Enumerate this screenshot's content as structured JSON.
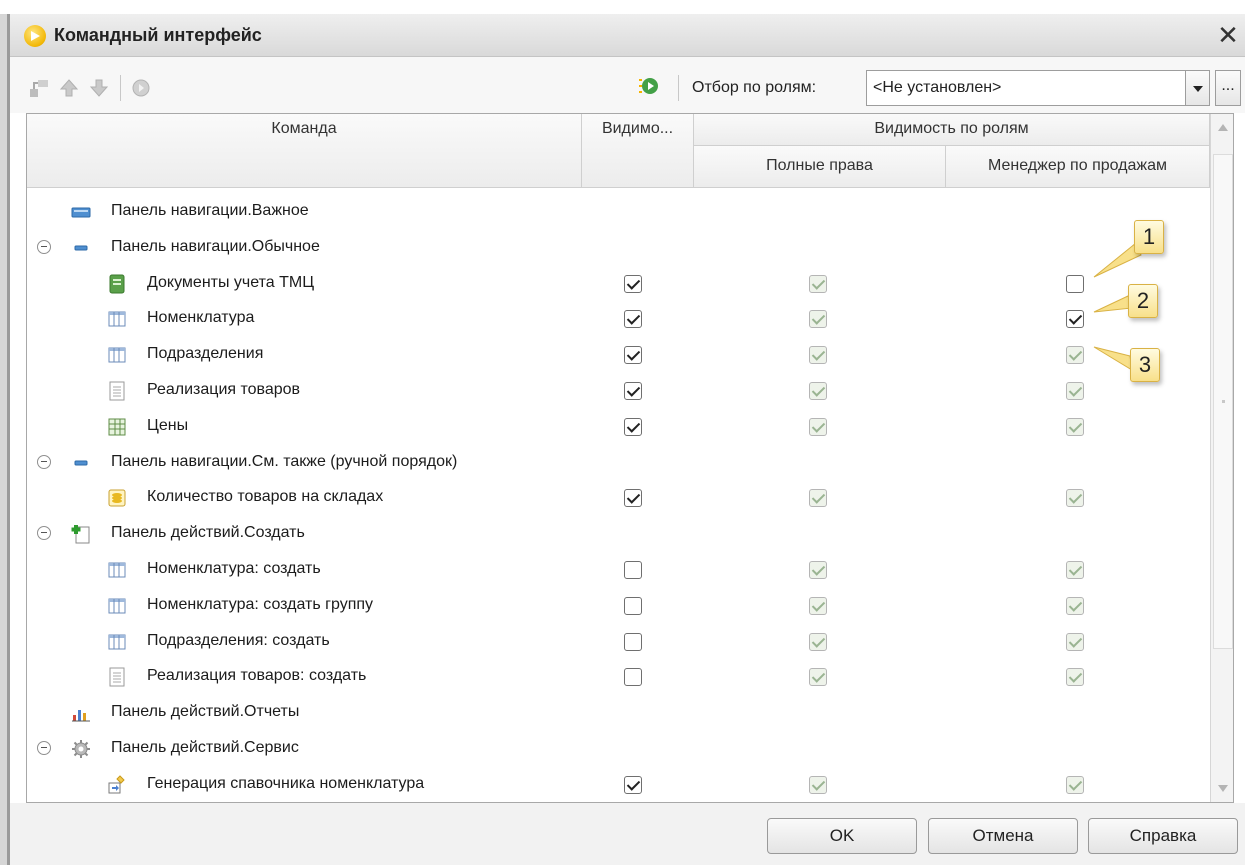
{
  "window": {
    "title": "Командный интерфейс"
  },
  "toolbar": {
    "filter_label": "Отбор по ролям:",
    "filter_value": "<Не установлен>",
    "more_label": "..."
  },
  "table": {
    "headers": {
      "command": "Команда",
      "visible": "Видимо...",
      "visibility_by_roles": "Видимость по ролям",
      "role_full_rights": "Полные права",
      "role_sales_manager": "Менеджер по продажам"
    },
    "rows": [
      {
        "label": "Панель навигации.Важное",
        "icon": "navigation-panel-important-icon"
      },
      {
        "label": "Панель навигации.Обычное",
        "icon": "navigation-panel-icon"
      },
      {
        "label": "Документы учета ТМЦ",
        "icon": "subsystem-icon",
        "visible": true,
        "full_rights": true,
        "manager": false
      },
      {
        "label": "Номенклатура",
        "icon": "catalog-icon",
        "visible": true,
        "full_rights": true,
        "manager": true
      },
      {
        "label": "Подразделения",
        "icon": "catalog-icon",
        "visible": true,
        "full_rights": true,
        "manager": true
      },
      {
        "label": "Реализация товаров",
        "icon": "document-icon",
        "visible": true,
        "full_rights": true,
        "manager": true
      },
      {
        "label": "Цены",
        "icon": "register-icon",
        "visible": true,
        "full_rights": true,
        "manager": true
      },
      {
        "label": "Панель навигации.См. также (ручной порядок)",
        "icon": "navigation-panel-icon"
      },
      {
        "label": "Количество товаров на складах",
        "icon": "accumulation-register-icon",
        "visible": true,
        "full_rights": true,
        "manager": true
      },
      {
        "label": "Панель действий.Создать",
        "icon": "create-action-icon"
      },
      {
        "label": "Номенклатура: создать",
        "icon": "catalog-icon",
        "visible": false,
        "full_rights": true,
        "manager": true
      },
      {
        "label": "Номенклатура: создать группу",
        "icon": "catalog-icon",
        "visible": false,
        "full_rights": true,
        "manager": true
      },
      {
        "label": "Подразделения: создать",
        "icon": "catalog-icon",
        "visible": false,
        "full_rights": true,
        "manager": true
      },
      {
        "label": "Реализация товаров: создать",
        "icon": "document-icon",
        "visible": false,
        "full_rights": true,
        "manager": true
      },
      {
        "label": "Панель действий.Отчеты",
        "icon": "reports-icon"
      },
      {
        "label": "Панель действий.Сервис",
        "icon": "service-gear-icon"
      },
      {
        "label": "Генерация спавочника номенклатура",
        "icon": "data-processor-icon",
        "visible": true,
        "full_rights": true,
        "manager": true
      }
    ]
  },
  "callouts": [
    "1",
    "2",
    "3"
  ],
  "buttons": {
    "ok": "OK",
    "cancel": "Отмена",
    "help": "Справка"
  },
  "colors": {
    "checkbox_disabled_fill": "#eef3ea",
    "callout_fill": "#f8e08a",
    "title_bar": "#dcdcdc"
  }
}
